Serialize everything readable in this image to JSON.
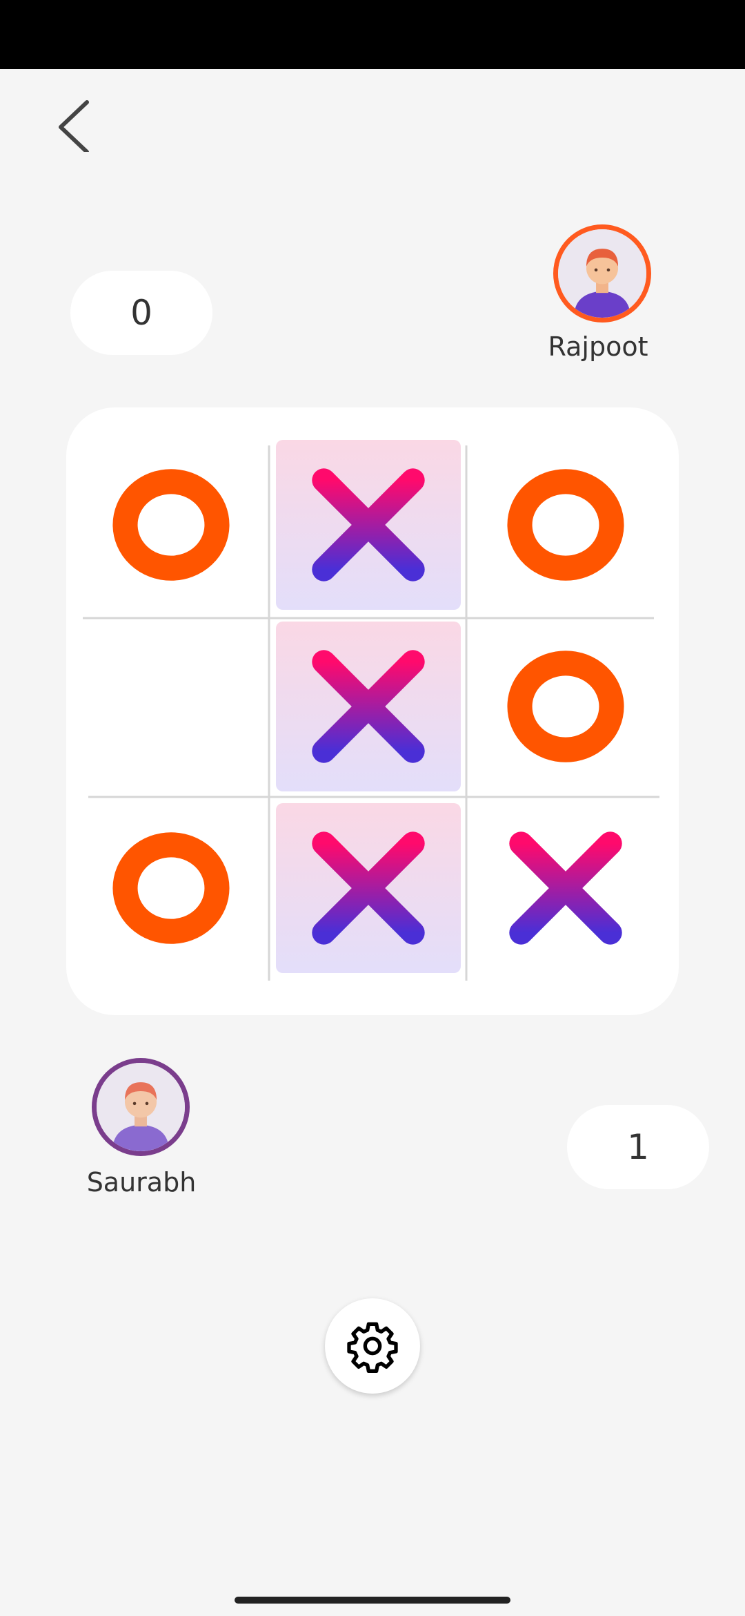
{
  "player_top": {
    "name": "Rajpoot",
    "score": "0",
    "mark": "O",
    "ring_color": "#ff5a1f"
  },
  "player_bottom": {
    "name": "Saurabh",
    "score": "1",
    "mark": "X",
    "ring_color": "#7a3d8c"
  },
  "board": {
    "cells": [
      "O",
      "X",
      "O",
      "",
      "X",
      "O",
      "O",
      "X",
      "X"
    ],
    "winning_cells": [
      1,
      4,
      7
    ]
  },
  "colors": {
    "o_mark": "#ff5500",
    "x_gradient_top": "#ff0a6c",
    "x_gradient_bottom": "#4a2fd6"
  },
  "icons": {
    "back": "chevron-left-icon",
    "settings": "gear-icon",
    "avatar": "user-avatar-icon"
  }
}
